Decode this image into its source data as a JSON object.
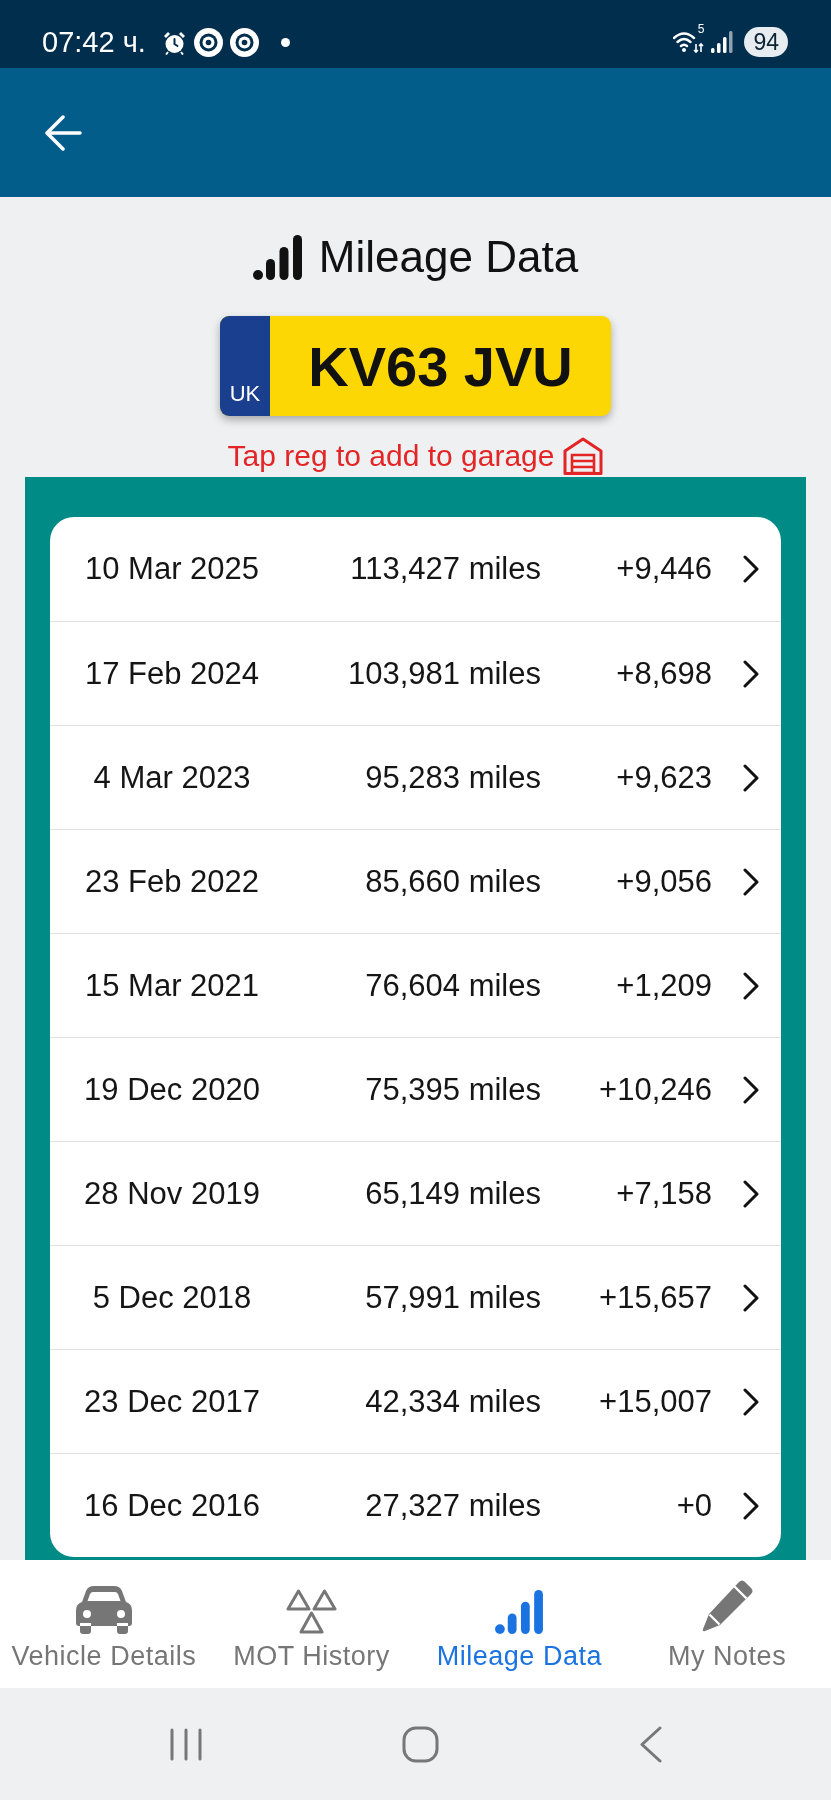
{
  "status_bar": {
    "time": "07:42 ч.",
    "wifi_band": "5",
    "battery": "94"
  },
  "title": "Mileage Data",
  "plate": {
    "country": "UK",
    "registration": "KV63 JVU"
  },
  "hint": "Tap reg to add to garage",
  "records": [
    {
      "date": "10 Mar 2025",
      "mileage": "113,427 miles",
      "change": "+9,446"
    },
    {
      "date": "17 Feb 2024",
      "mileage": "103,981 miles",
      "change": "+8,698"
    },
    {
      "date": "4 Mar 2023",
      "mileage": "95,283 miles",
      "change": "+9,623"
    },
    {
      "date": "23 Feb 2022",
      "mileage": "85,660 miles",
      "change": "+9,056"
    },
    {
      "date": "15 Mar 2021",
      "mileage": "76,604 miles",
      "change": "+1,209"
    },
    {
      "date": "19 Dec 2020",
      "mileage": "75,395 miles",
      "change": "+10,246"
    },
    {
      "date": "28 Nov 2019",
      "mileage": "65,149 miles",
      "change": "+7,158"
    },
    {
      "date": "5 Dec 2018",
      "mileage": "57,991 miles",
      "change": "+15,657"
    },
    {
      "date": "23 Dec 2017",
      "mileage": "42,334 miles",
      "change": "+15,007"
    },
    {
      "date": "16 Dec 2016",
      "mileage": "27,327 miles",
      "change": "+0"
    }
  ],
  "bottom_nav": [
    {
      "label": "Vehicle Details",
      "selected": false
    },
    {
      "label": "MOT History",
      "selected": false
    },
    {
      "label": "Mileage Data",
      "selected": true
    },
    {
      "label": "My Notes",
      "selected": false
    }
  ]
}
